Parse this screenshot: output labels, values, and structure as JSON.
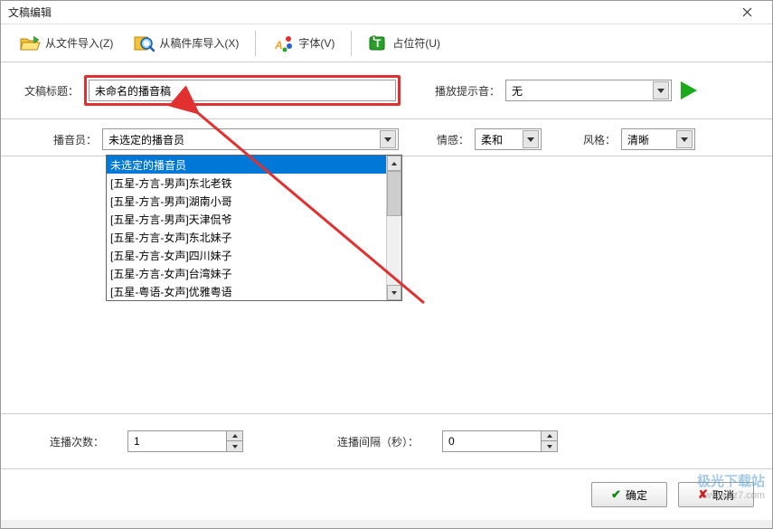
{
  "window": {
    "title": "文稿编辑"
  },
  "toolbar": {
    "import_file": "从文件导入(Z)",
    "import_library": "从稿件库导入(X)",
    "font": "字体(V)",
    "placeholder": "占位符(U)"
  },
  "title_row": {
    "label": "文稿标题：",
    "value": "未命名的播音稿",
    "play_sound_label": "播放提示音：",
    "play_sound_value": "无"
  },
  "announcer": {
    "label": "播音员：",
    "value": "未选定的播音员",
    "options": [
      "未选定的播音员",
      "[五星-方言-男声]东北老铁",
      "[五星-方言-男声]湖南小哥",
      "[五星-方言-男声]天津侃爷",
      "[五星-方言-女声]东北妹子",
      "[五星-方言-女声]四川妹子",
      "[五星-方言-女声]台湾妹子",
      "[五星-粤语-女声]优雅粤语"
    ]
  },
  "emotion": {
    "label": "情感：",
    "value": "柔和"
  },
  "style": {
    "label": "风格：",
    "value": "清晰"
  },
  "bottom": {
    "repeat_label": "连播次数：",
    "repeat_value": "1",
    "interval_label": "连播间隔（秒）：",
    "interval_value": "0"
  },
  "buttons": {
    "ok": "确定",
    "cancel": "取消"
  },
  "watermark": {
    "line1": "极光下载站",
    "line2": "www.xz7.com"
  }
}
